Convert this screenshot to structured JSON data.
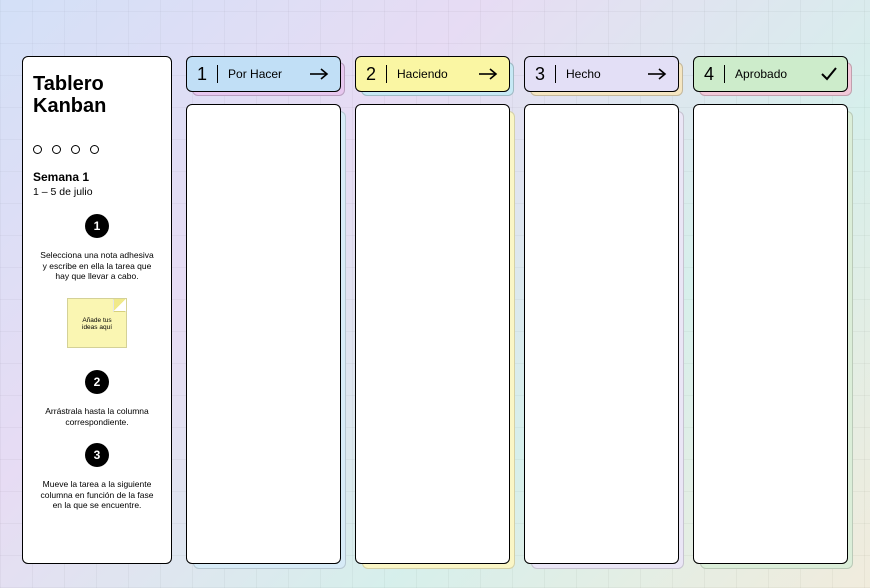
{
  "sidebar": {
    "title": "Tablero Kanban",
    "week_label": "Semana 1",
    "week_dates": "1 – 5 de julio",
    "step1_num": "1",
    "step1_text": "Selecciona una nota adhesiva y escribe en ella la tarea que hay que llevar a cabo.",
    "sticky_text": "Añade tus ideas aquí",
    "step2_num": "2",
    "step2_text": "Arrástrala hasta la columna correspondiente.",
    "step3_num": "3",
    "step3_text": "Mueve la tarea a la siguiente columna en función de la fase en la que se encuentre."
  },
  "columns": [
    {
      "num": "1",
      "label": "Por Hacer",
      "icon": "arrow"
    },
    {
      "num": "2",
      "label": "Haciendo",
      "icon": "arrow"
    },
    {
      "num": "3",
      "label": "Hecho",
      "icon": "arrow"
    },
    {
      "num": "4",
      "label": "Aprobado",
      "icon": "check"
    }
  ],
  "colors": {
    "header_bg": [
      "#c1dff6",
      "#faf6a3",
      "#e3dff6",
      "#cdeccb"
    ],
    "header_shadow": [
      "#e7c7ef",
      "#c7e9f5",
      "#f5e6c2",
      "#f2c9d9"
    ],
    "body_shadow": [
      "#d7ebf7",
      "#faf6c6",
      "#eae6f6",
      "#dbeed9"
    ]
  }
}
